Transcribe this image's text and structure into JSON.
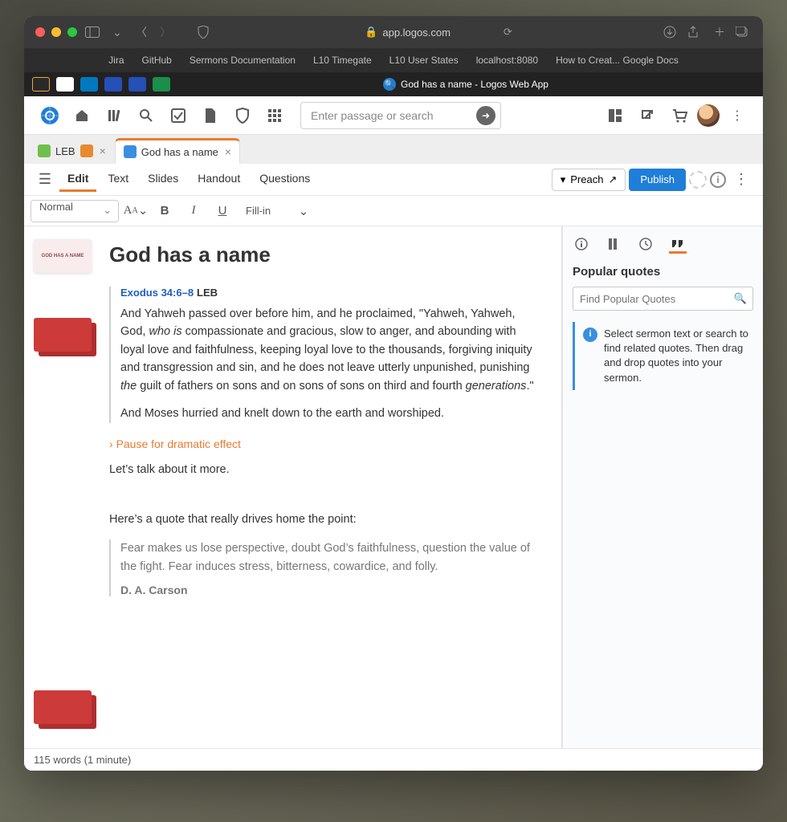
{
  "browser": {
    "url": "app.logos.com",
    "bookmarks": [
      "Jira",
      "GitHub",
      "Sermons Documentation",
      "L10 Timegate",
      "L10 User States",
      "localhost:8080",
      "How to Creat... Google Docs"
    ],
    "tab_title": "God has a name - Logos Web App"
  },
  "toolbar": {
    "search_placeholder": "Enter passage or search"
  },
  "doc_tabs": {
    "0": {
      "label": "LEB"
    },
    "1": {
      "label": "God has a name"
    }
  },
  "menu": {
    "edit": "Edit",
    "text": "Text",
    "slides": "Slides",
    "handout": "Handout",
    "questions": "Questions",
    "preach": "Preach",
    "publish": "Publish"
  },
  "format": {
    "style": "Normal",
    "fillin": "Fill-in"
  },
  "doc": {
    "title": "God has a name",
    "scripture_ref": "Exodus 34:6–8",
    "scripture_ver": "LEB",
    "scripture_p1": "And Yahweh passed over before him, and he proclaimed, “Yahweh, Yahweh, God, who is compassionate and gracious, slow to anger, and abounding with loyal love and faithfulness, keeping loyal love to the thousands, forgiving iniquity and transgression and sin, and he does not leave utterly unpunished, punishing the guilt of fathers on sons and on sons of sons on third and fourth generations.”",
    "scripture_p2": "And Moses hurried and knelt down to the earth and worshiped.",
    "cue": "Pause for dramatic effect",
    "p1": "Let’s talk about it more.",
    "p2": "Here’s a quote that really drives home the point:",
    "quote_text": "Fear makes us lose perspective, doubt God’s faithfulness, question the value of the fight. Fear induces stress, bitterness, cowardice, and folly.",
    "quote_author": "D. A. Carson",
    "status": "115 words (1 minute)"
  },
  "sidebar": {
    "heading": "Popular quotes",
    "search_placeholder": "Find Popular Quotes",
    "tip": "Select sermon text or search to find related quotes. Then drag and drop quotes into your sermon."
  }
}
